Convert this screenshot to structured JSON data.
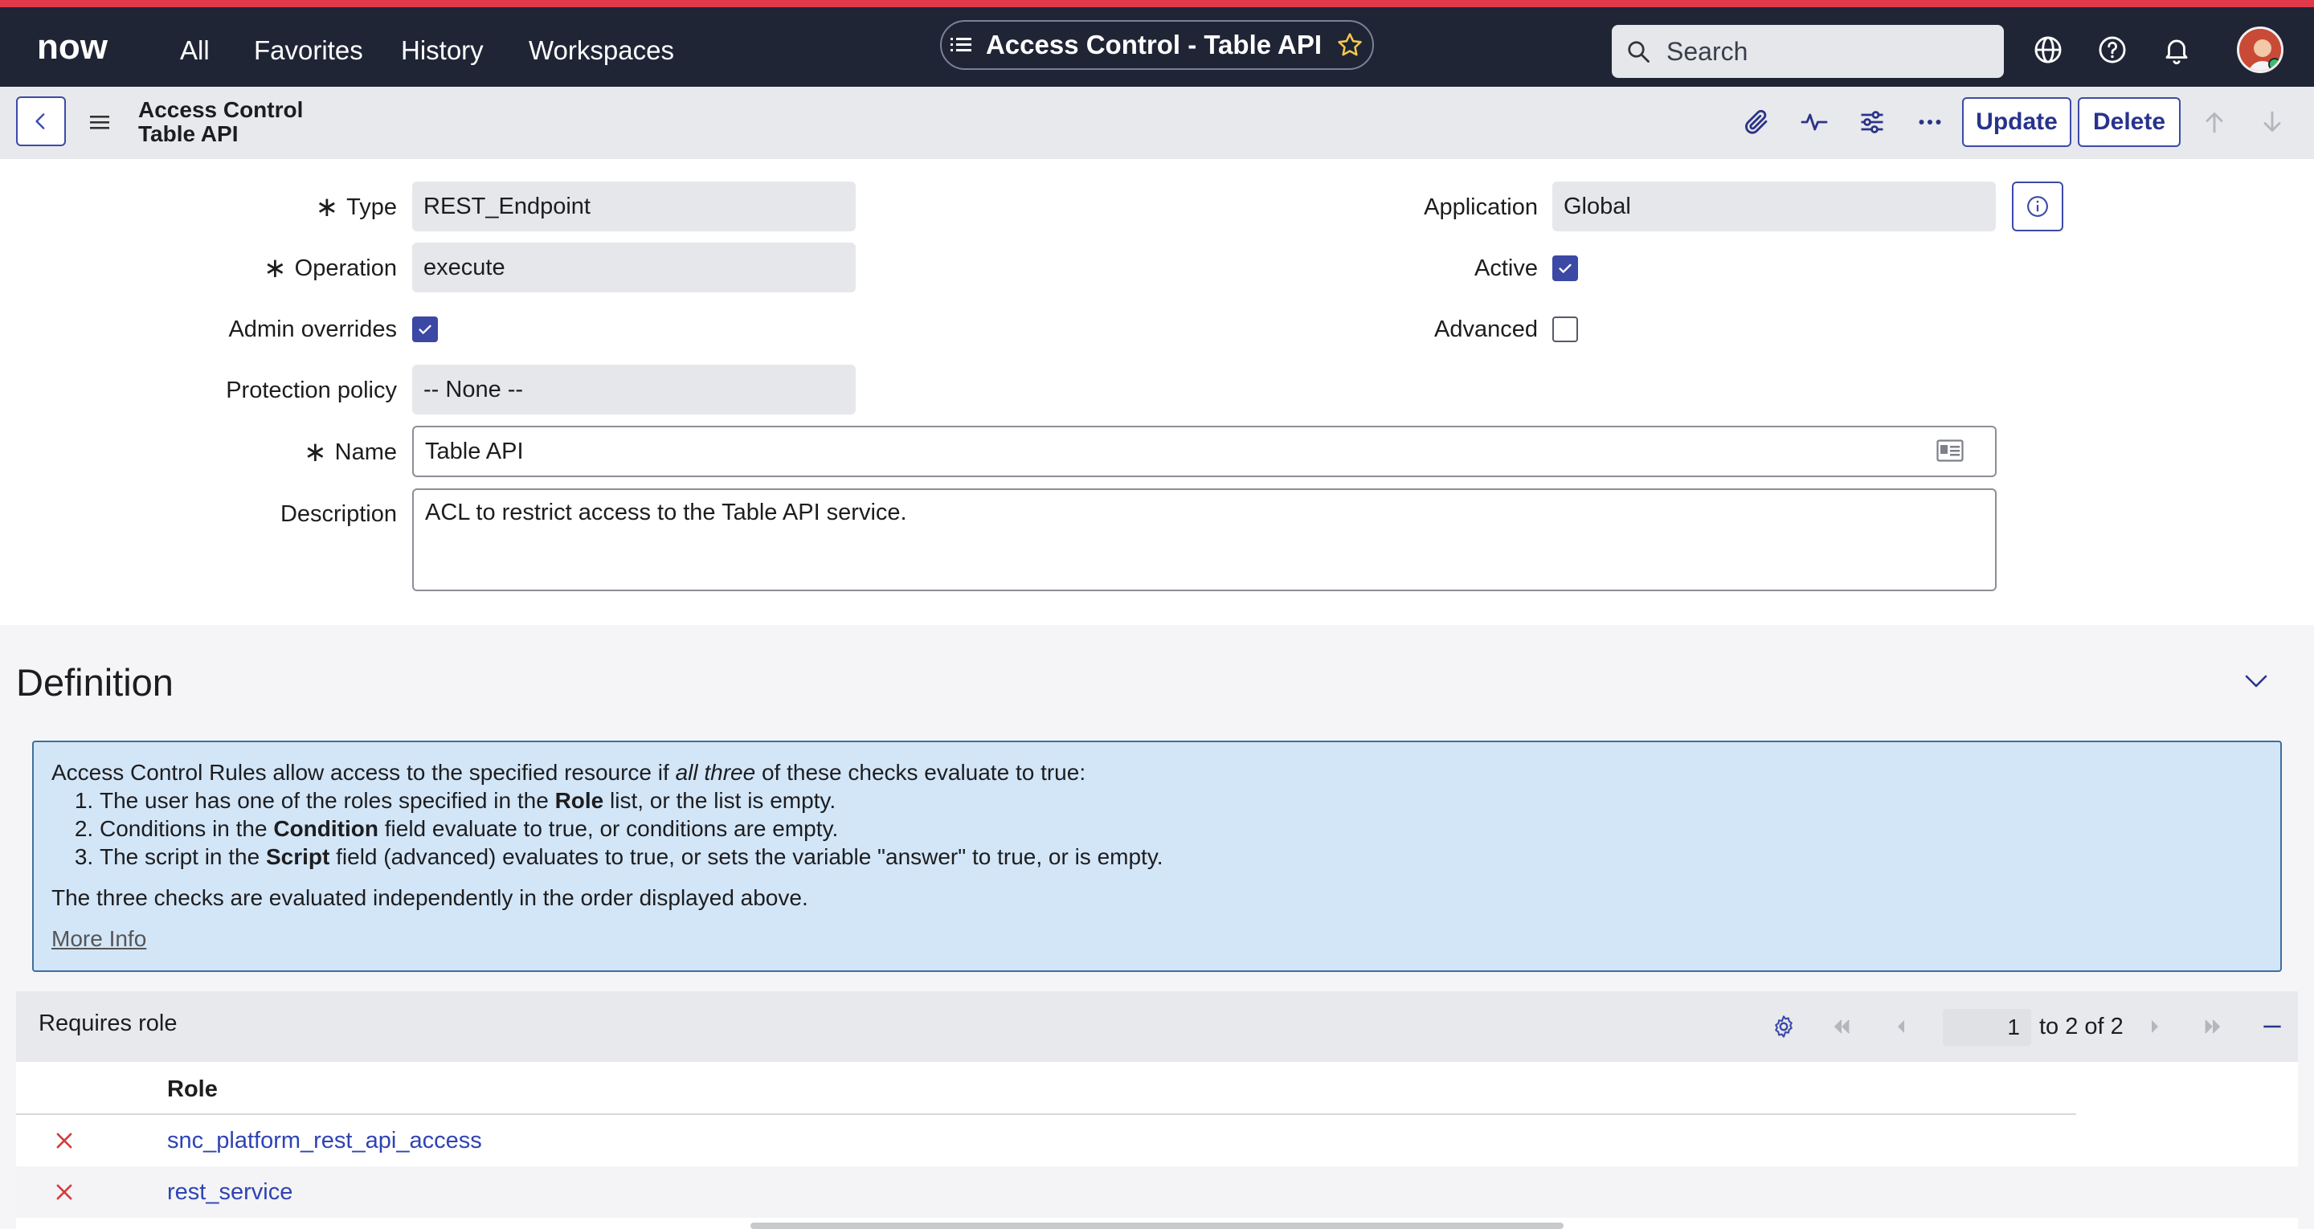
{
  "topnav": {
    "logo_text": "now",
    "links": [
      "All",
      "Favorites",
      "History",
      "Workspaces"
    ],
    "title": "Access Control - Table API",
    "search_placeholder": "Search"
  },
  "header": {
    "title_line1": "Access Control",
    "title_line2": "Table API",
    "update_label": "Update",
    "delete_label": "Delete"
  },
  "form": {
    "type": {
      "label": "Type",
      "value": "REST_Endpoint"
    },
    "operation": {
      "label": "Operation",
      "value": "execute"
    },
    "admin_overrides": {
      "label": "Admin overrides",
      "checked": true
    },
    "protection_policy": {
      "label": "Protection policy",
      "value": "-- None --"
    },
    "name": {
      "label": "Name",
      "value": "Table API"
    },
    "description": {
      "label": "Description",
      "value": "ACL to restrict access to the Table API service."
    },
    "application": {
      "label": "Application",
      "value": "Global"
    },
    "active": {
      "label": "Active",
      "checked": true
    },
    "advanced": {
      "label": "Advanced",
      "checked": false
    }
  },
  "definition": {
    "title": "Definition",
    "intro_pre": "Access Control Rules allow access to the specified resource if ",
    "intro_em": "all three",
    "intro_post": " of these checks evaluate to true:",
    "items": [
      {
        "pre": "The user has one of the roles specified in the ",
        "bold": "Role",
        "post": " list, or the list is empty."
      },
      {
        "pre": "Conditions in the ",
        "bold": "Condition",
        "post": " field evaluate to true, or conditions are empty."
      },
      {
        "pre": "The script in the ",
        "bold": "Script",
        "post": " field (advanced) evaluates to true, or sets the variable \"answer\" to true, or is empty."
      }
    ],
    "note": "The three checks are evaluated independently in the order displayed above.",
    "more_info": "More Info"
  },
  "related_list": {
    "title": "Requires role",
    "page_value": "1",
    "page_text": "to 2 of 2",
    "column": "Role",
    "rows": [
      "snc_platform_rest_api_access",
      "rest_service"
    ]
  },
  "colors": {
    "nav_bg": "#202536",
    "accent_red": "#e0394a",
    "primary_blue": "#3b48a4",
    "info_bg": "#d3e6f8",
    "link": "#2f43b4"
  }
}
